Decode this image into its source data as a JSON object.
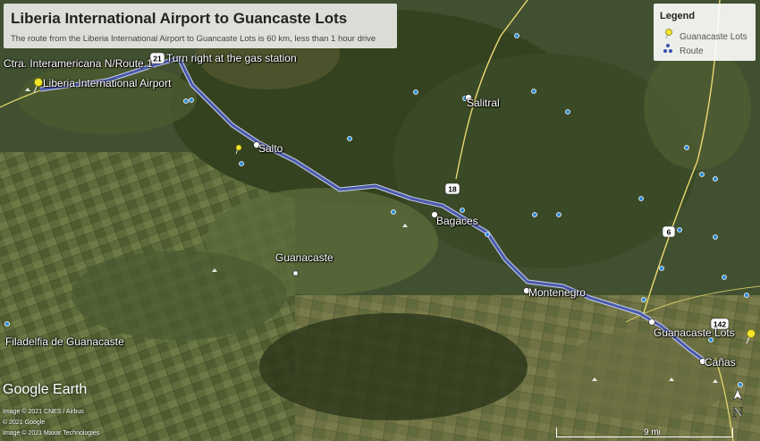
{
  "title": {
    "heading": "Liberia International Airport to Guancaste Lots",
    "subheading": "The route from the Liberia International Airport to Guancaste Lots is 60 km, less than 1 hour drive"
  },
  "legend": {
    "heading": "Legend",
    "items": [
      {
        "label": "Guanacaste Lots",
        "icon": "yellow-pushpin-icon",
        "color": "#f2e52a"
      },
      {
        "label": "Route",
        "icon": "route-dots-icon",
        "color": "#3a4fb0"
      }
    ]
  },
  "places": {
    "ctra": "Ctra. Interamericana N/Route 1",
    "turn": "Turn right at the gas station",
    "airport": "Liberia International Airport",
    "salitral": "Salitral",
    "salto": "Salto",
    "bagaces": "Bagaces",
    "guanacaste": "Guanacaste",
    "montenegro": "Montenegro",
    "lots": "Guanacaste Lots",
    "canas": "Cañas",
    "filadelfia": "Filadelfia de Guanacaste"
  },
  "road_shields": [
    "21",
    "18",
    "6",
    "142"
  ],
  "branding": {
    "logo": "Google Earth",
    "credits": [
      "Image © 2021 CNES / Airbus",
      "© 2021 Google",
      "Image © 2021 Maxar Technologies"
    ]
  },
  "scale_bar": "9 mi",
  "compass": "N",
  "colors": {
    "route": "#4a5aa8",
    "route_edge": "#c8cdf0",
    "pin": "#f2e52a",
    "road": "#e9d870"
  }
}
